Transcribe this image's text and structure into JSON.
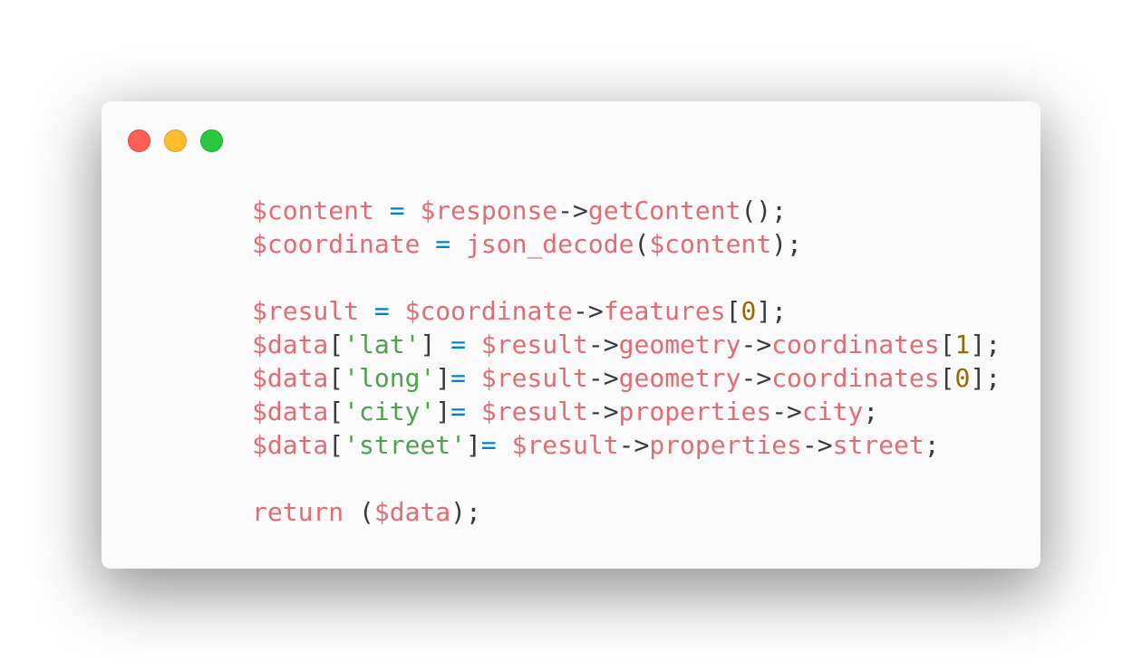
{
  "window": {
    "controls": [
      {
        "name": "close",
        "color": "#ff5f56"
      },
      {
        "name": "minimize",
        "color": "#ffbd2e"
      },
      {
        "name": "maximize",
        "color": "#27c93f"
      }
    ]
  },
  "theme": {
    "background": "#fafafa",
    "variable": "#e06c75",
    "operator": "#0184bc",
    "string": "#50a14f",
    "number": "#986801",
    "punctuation": "#383a42"
  },
  "code": {
    "lines": [
      [
        [
          "var",
          "$content"
        ],
        [
          "punc",
          " "
        ],
        [
          "op",
          "="
        ],
        [
          "punc",
          " "
        ],
        [
          "var",
          "$response"
        ],
        [
          "punc",
          "->"
        ],
        [
          "fn",
          "getContent"
        ],
        [
          "punc",
          "();"
        ]
      ],
      [
        [
          "var",
          "$coordinate"
        ],
        [
          "punc",
          " "
        ],
        [
          "op",
          "="
        ],
        [
          "punc",
          " "
        ],
        [
          "fn",
          "json_decode"
        ],
        [
          "punc",
          "("
        ],
        [
          "var",
          "$content"
        ],
        [
          "punc",
          ");"
        ]
      ],
      [],
      [
        [
          "var",
          "$result"
        ],
        [
          "punc",
          " "
        ],
        [
          "op",
          "="
        ],
        [
          "punc",
          " "
        ],
        [
          "var",
          "$coordinate"
        ],
        [
          "punc",
          "->"
        ],
        [
          "fn",
          "features"
        ],
        [
          "punc",
          "["
        ],
        [
          "num",
          "0"
        ],
        [
          "punc",
          "];"
        ]
      ],
      [
        [
          "var",
          "$data"
        ],
        [
          "punc",
          "["
        ],
        [
          "str",
          "'lat'"
        ],
        [
          "punc",
          "] "
        ],
        [
          "op",
          "="
        ],
        [
          "punc",
          " "
        ],
        [
          "var",
          "$result"
        ],
        [
          "punc",
          "->"
        ],
        [
          "fn",
          "geometry"
        ],
        [
          "punc",
          "->"
        ],
        [
          "fn",
          "coordinates"
        ],
        [
          "punc",
          "["
        ],
        [
          "num",
          "1"
        ],
        [
          "punc",
          "];"
        ]
      ],
      [
        [
          "var",
          "$data"
        ],
        [
          "punc",
          "["
        ],
        [
          "str",
          "'long'"
        ],
        [
          "punc",
          "]"
        ],
        [
          "op",
          "="
        ],
        [
          "punc",
          " "
        ],
        [
          "var",
          "$result"
        ],
        [
          "punc",
          "->"
        ],
        [
          "fn",
          "geometry"
        ],
        [
          "punc",
          "->"
        ],
        [
          "fn",
          "coordinates"
        ],
        [
          "punc",
          "["
        ],
        [
          "num",
          "0"
        ],
        [
          "punc",
          "];"
        ]
      ],
      [
        [
          "var",
          "$data"
        ],
        [
          "punc",
          "["
        ],
        [
          "str",
          "'city'"
        ],
        [
          "punc",
          "]"
        ],
        [
          "op",
          "="
        ],
        [
          "punc",
          " "
        ],
        [
          "var",
          "$result"
        ],
        [
          "punc",
          "->"
        ],
        [
          "fn",
          "properties"
        ],
        [
          "punc",
          "->"
        ],
        [
          "fn",
          "city"
        ],
        [
          "punc",
          ";"
        ]
      ],
      [
        [
          "var",
          "$data"
        ],
        [
          "punc",
          "["
        ],
        [
          "str",
          "'street'"
        ],
        [
          "punc",
          "]"
        ],
        [
          "op",
          "="
        ],
        [
          "punc",
          " "
        ],
        [
          "var",
          "$result"
        ],
        [
          "punc",
          "->"
        ],
        [
          "fn",
          "properties"
        ],
        [
          "punc",
          "->"
        ],
        [
          "fn",
          "street"
        ],
        [
          "punc",
          ";"
        ]
      ],
      [],
      [
        [
          "kw",
          "return"
        ],
        [
          "punc",
          " ("
        ],
        [
          "var",
          "$data"
        ],
        [
          "punc",
          ");"
        ]
      ]
    ]
  }
}
